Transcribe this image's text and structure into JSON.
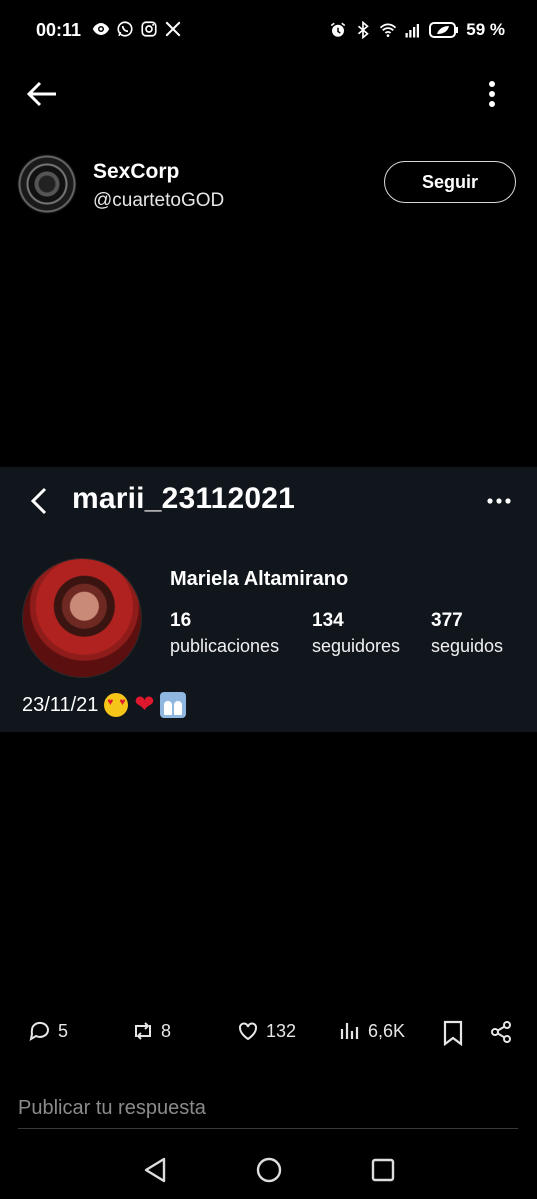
{
  "status_bar": {
    "time": "00:11",
    "battery": "59 %",
    "left_icons": [
      "eye-icon",
      "whatsapp-icon",
      "instagram-icon",
      "x-icon"
    ],
    "right_icons": [
      "alarm-icon",
      "bluetooth-icon",
      "wifi-icon",
      "signal-icon",
      "battery-icon"
    ]
  },
  "author": {
    "name": "SexCorp",
    "handle": "@cuartetoGOD",
    "follow_label": "Seguir"
  },
  "embedded_profile": {
    "username": "marii_23112021",
    "full_name": "Mariela Altamirano",
    "stats": [
      {
        "value": "16",
        "label": "publicaciones"
      },
      {
        "value": "134",
        "label": "seguidores"
      },
      {
        "value": "377",
        "label": "seguidos"
      }
    ],
    "bio": "23/11/21"
  },
  "actions": {
    "replies": "5",
    "reposts": "8",
    "likes": "132",
    "views": "6,6K"
  },
  "reply": {
    "placeholder": "Publicar tu respuesta"
  }
}
